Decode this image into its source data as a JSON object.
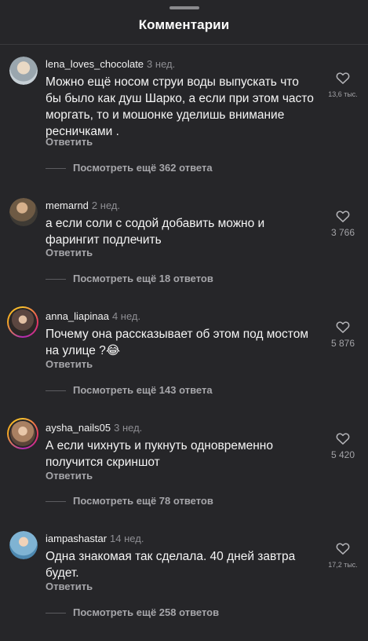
{
  "header": {
    "title": "Комментарии"
  },
  "comments": [
    {
      "username": "lena_loves_chocolate",
      "time": "3 нед.",
      "text": "Можно ещё носом струи воды выпускать что бы было как душ Шарко, а если при этом часто моргать, то и мошонке уделишь внимание ресничками .",
      "reply_label": "Ответить",
      "view_replies": "Посмотреть ещё 362 ответа",
      "likes": "13,6 тыс.",
      "avatar_color": "#b7c3cc"
    },
    {
      "username": "memarnd",
      "time": "2 нед.",
      "text": "а если соли с содой добавить можно и фарингит подлечить",
      "reply_label": "Ответить",
      "view_replies": "Посмотреть ещё 18 ответов",
      "likes": "3 766",
      "avatar_color": "#7a6a58"
    },
    {
      "username": "anna_liapinaa",
      "time": "4 нед.",
      "text": "Почему она рассказывает об этом под мостом на улице ?😂",
      "reply_label": "Ответить",
      "view_replies": "Посмотреть ещё 143 ответа",
      "likes": "5 876",
      "avatar_color": "#4a3a36"
    },
    {
      "username": "aysha_nails05",
      "time": "3 нед.",
      "text": "А если чихнуть и пукнуть одновременно получится скриншот",
      "reply_label": "Ответить",
      "view_replies": "Посмотреть ещё 78 ответов",
      "likes": "5 420",
      "avatar_color": "#c9a58a"
    },
    {
      "username": "iampashastar",
      "time": "14 нед.",
      "text": "Одна знакомая так сделала. 40 дней завтра будет.",
      "reply_label": "Ответить",
      "view_replies": "Посмотреть ещё 258 ответов",
      "likes": "17,2 тыс.",
      "avatar_color": "#6fa6c8"
    }
  ]
}
